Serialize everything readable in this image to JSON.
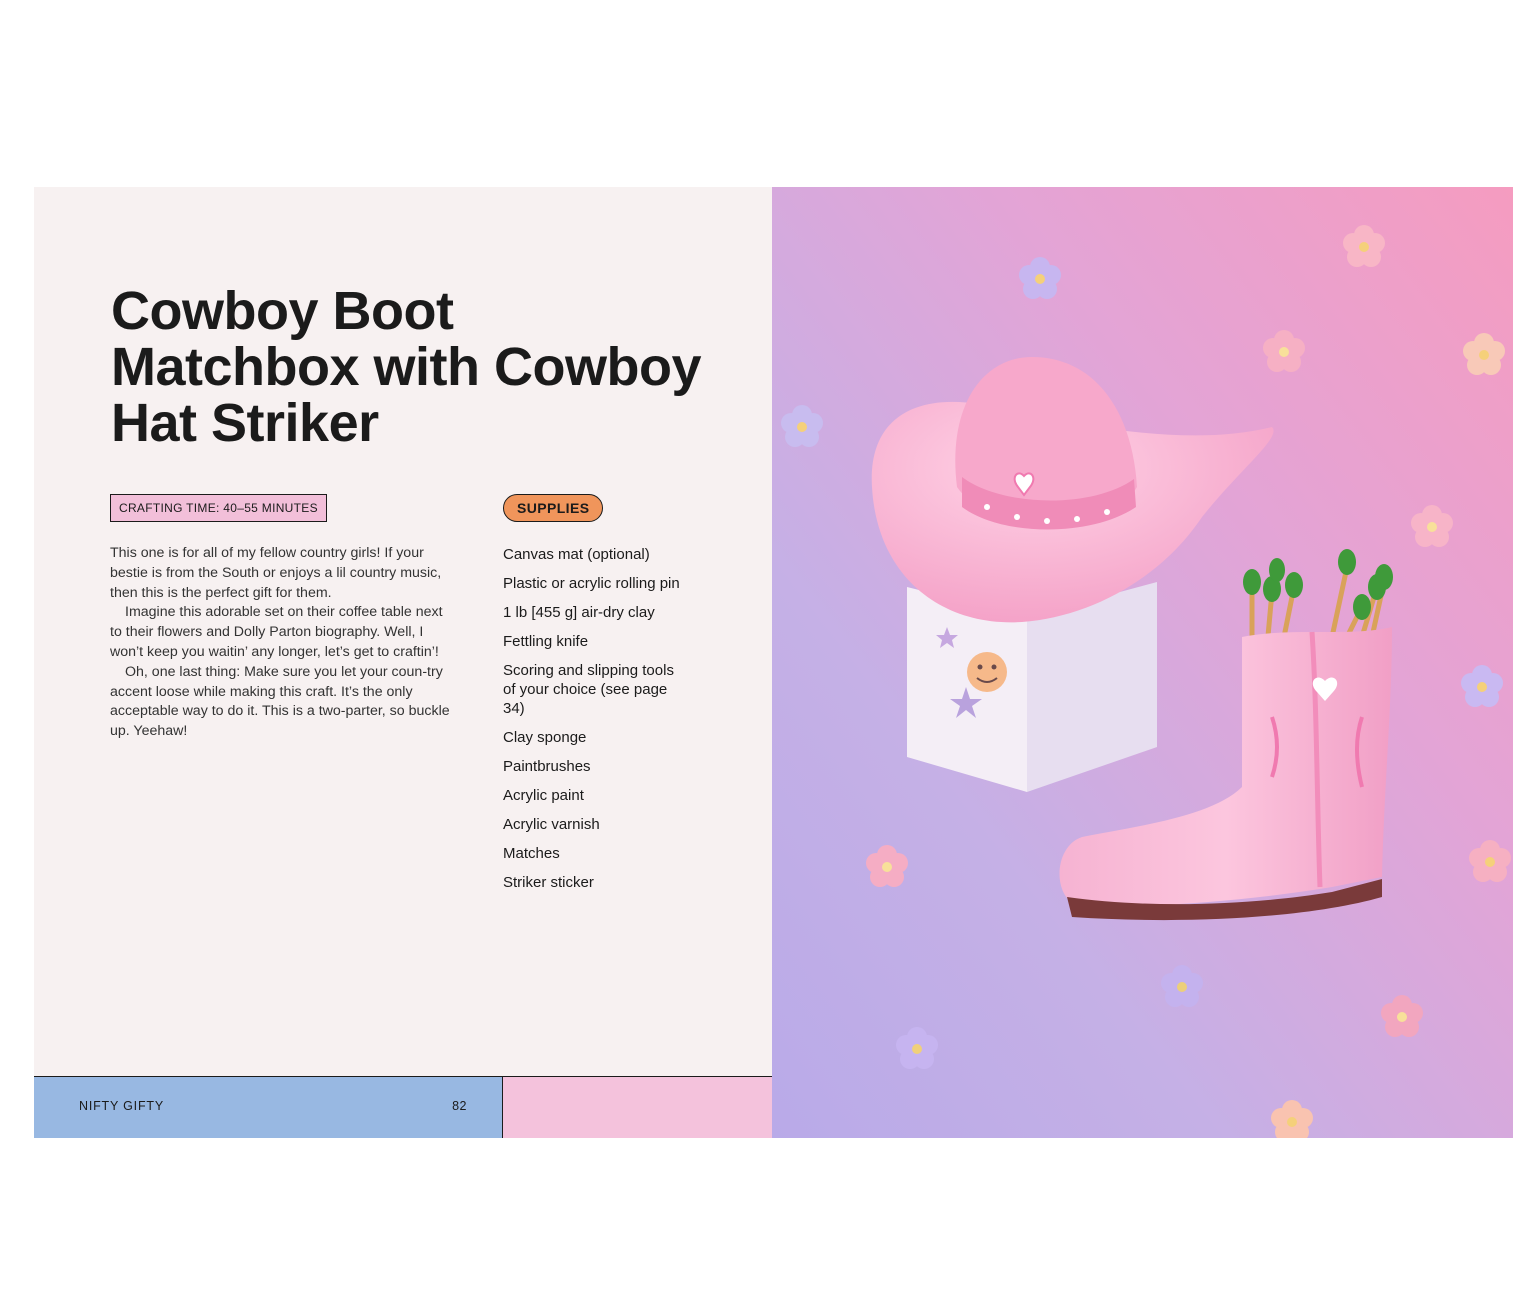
{
  "page": {
    "title": "Cowboy Boot Matchbox with Cowboy Hat Striker",
    "crafting_time": "CRAFTING TIME: 40–55 MINUTES",
    "supplies_label": "SUPPLIES",
    "intro": [
      "This one is for all of my fellow country girls! If your bestie is from the South or enjoys a lil country music, then this is the perfect gift for them.",
      "Imagine this adorable set on their coffee table next to their flowers and Dolly Parton biography. Well, I won’t keep you waitin’ any longer, let’s get to craftin’!",
      "Oh, one last thing: Make sure you let your coun-try accent loose while making this craft. It’s the only acceptable way to do it. This is a two-parter, so buckle up. Yeehaw!"
    ],
    "supplies": [
      "Canvas mat (optional)",
      "Plastic or acrylic rolling pin",
      "1 lb [455 g] air-dry clay",
      "Fettling knife",
      "Scoring and slipping tools of your choice (see page 34)",
      "Clay sponge",
      "Paintbrushes",
      "Acrylic paint",
      "Acrylic varnish",
      "Matches",
      "Striker sticker"
    ]
  },
  "footer": {
    "section": "NIFTY GIFTY",
    "page_number": "82"
  },
  "colors": {
    "page_background": "#f7f1f1",
    "title_text": "#1b1b1b",
    "time_badge": "#f2bfd9",
    "supplies_badge": "#f0955b",
    "footer_blue": "#98b8e2",
    "footer_pink": "#f4c2dc",
    "photo_pink": "#f19bc4",
    "photo_lavender": "#bfb0e6"
  },
  "photo": {
    "subjects": [
      "cowboy-hat-striker",
      "cowboy-boot-matchbox",
      "matches",
      "flower-patches"
    ]
  }
}
